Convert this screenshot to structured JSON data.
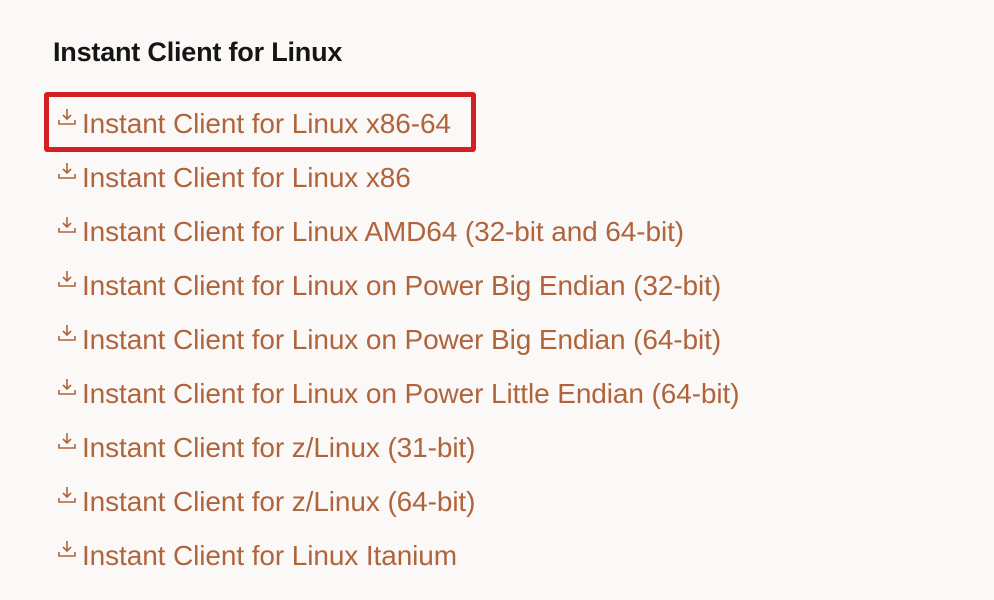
{
  "section": {
    "title": "Instant Client for Linux"
  },
  "links": [
    {
      "label": "Instant Client for Linux x86-64",
      "icon": "download-icon"
    },
    {
      "label": "Instant Client for Linux x86",
      "icon": "download-icon"
    },
    {
      "label": "Instant Client for Linux AMD64 (32-bit and 64-bit)",
      "icon": "download-icon"
    },
    {
      "label": "Instant Client for Linux on Power Big Endian (32-bit)",
      "icon": "download-icon"
    },
    {
      "label": "Instant Client for Linux on Power Big Endian (64-bit)",
      "icon": "download-icon"
    },
    {
      "label": "Instant Client for Linux on Power Little Endian (64-bit)",
      "icon": "download-icon"
    },
    {
      "label": "Instant Client for z/Linux (31-bit)",
      "icon": "download-icon"
    },
    {
      "label": "Instant Client for z/Linux (64-bit)",
      "icon": "download-icon"
    },
    {
      "label": "Instant Client for Linux Itanium",
      "icon": "download-icon"
    }
  ],
  "colors": {
    "link": "#b0643c",
    "title": "#161513",
    "background": "#fbf9f8",
    "highlight": "#d42020"
  }
}
